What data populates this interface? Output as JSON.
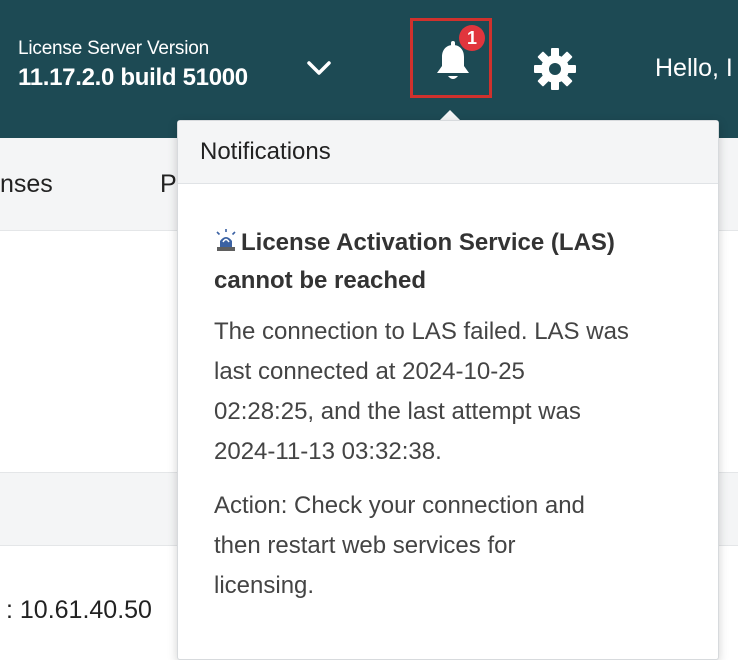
{
  "header": {
    "version_label": "License Server Version",
    "version_value": "11.17.2.0 build 51000",
    "greeting": "Hello, I",
    "notification_count": "1",
    "icons": [
      "chevron-down-icon",
      "bell-icon",
      "gear-icon"
    ]
  },
  "nav": {
    "items": [
      {
        "label": "nses"
      },
      {
        "label": "P"
      }
    ]
  },
  "main": {
    "ip_text": ": 10.61.40.50"
  },
  "notifications": {
    "title": "Notifications",
    "item": {
      "icon": "siren-icon",
      "title_line1": "License Activation Service (LAS)",
      "title_line2": "cannot be reached",
      "message_lines": [
        "The connection to LAS failed. LAS was",
        "last connected at 2024-10-25",
        "02:28:25, and the last attempt was",
        "2024-11-13 03:32:38."
      ],
      "action_lines": [
        "Action: Check your connection and",
        "then restart web services for",
        "licensing."
      ]
    }
  },
  "colors": {
    "header_bg": "#1d4a54",
    "highlight_border": "#d0312d",
    "badge_bg": "#e1353d",
    "panel_bg": "#f4f5f6"
  }
}
